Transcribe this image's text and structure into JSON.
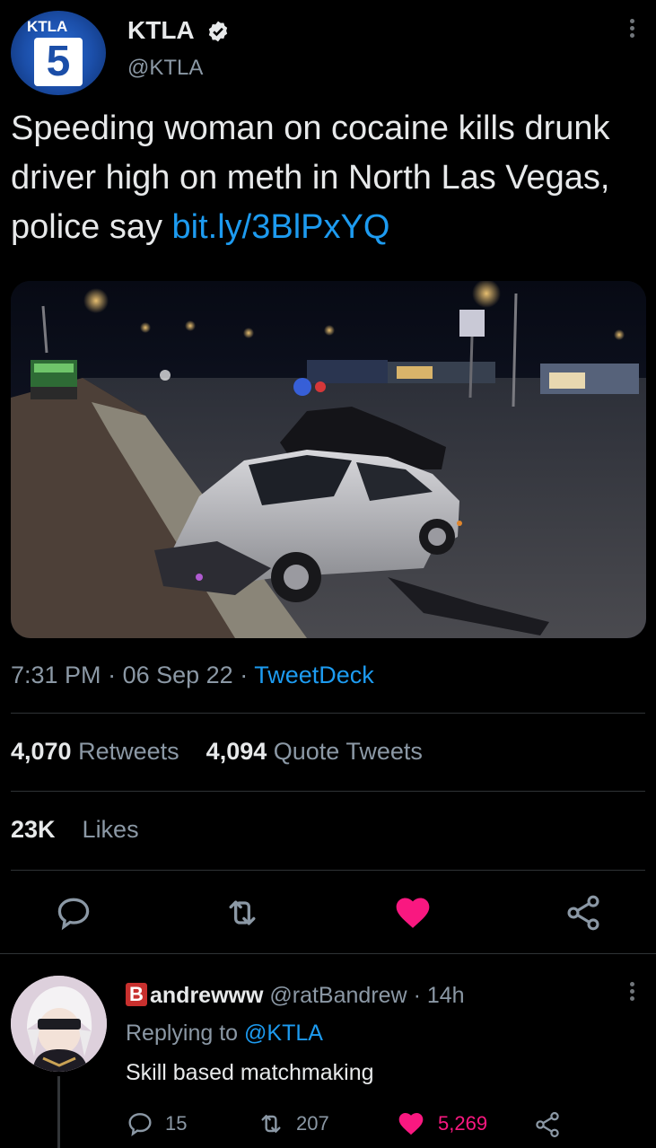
{
  "author": {
    "display_name": "KTLA",
    "handle": "@KTLA",
    "avatar_logo_text": "KTLA",
    "avatar_logo_number": "5"
  },
  "tweet": {
    "text": "Speeding woman on cocaine kills drunk driver high on meth in North Las Vegas, police say ",
    "link": "bit.ly/3BlPxYQ",
    "time": "7:31 PM",
    "date": "06 Sep 22",
    "separator": "·",
    "source": "TweetDeck"
  },
  "stats": {
    "retweets_count": "4,070",
    "retweets_label": "Retweets",
    "quotes_count": "4,094",
    "quotes_label": "Quote Tweets",
    "likes_count": "23K",
    "likes_label": "Likes"
  },
  "actions": {
    "reply_icon": "reply-icon",
    "retweet_icon": "retweet-icon",
    "like_icon": "heart-filled-icon",
    "share_icon": "share-icon",
    "like_color": "#f91880"
  },
  "reply": {
    "badge": "B",
    "display_name": "andrewww",
    "handle": "@ratBandrew",
    "separator": "·",
    "time": "14h",
    "replying_prefix": "Replying to",
    "replying_to": "@KTLA",
    "text": "Skill based matchmaking",
    "reply_count": "15",
    "retweet_count": "207",
    "like_count": "5,269"
  },
  "colors": {
    "background": "#000000",
    "text": "#e7e9ea",
    "muted": "#8b98a5",
    "link": "#1d9bf0",
    "divider": "#2f3336"
  }
}
